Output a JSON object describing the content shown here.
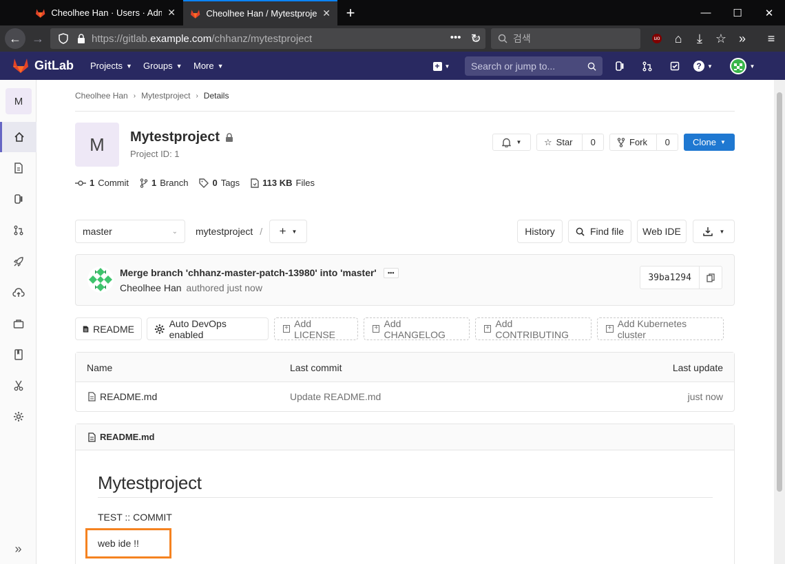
{
  "browser": {
    "tabs": [
      {
        "title": "Cheolhee Han · Users · Admin Area · GitLab"
      },
      {
        "title": "Cheolhee Han / Mytestproject · GitLab"
      }
    ],
    "url_prefix": "https://gitlab.",
    "url_host": "example.com",
    "url_path": "/chhanz/mytestproject",
    "search_placeholder": "검색"
  },
  "gitlab": {
    "brand": "GitLab",
    "nav": [
      {
        "label": "Projects"
      },
      {
        "label": "Groups"
      },
      {
        "label": "More"
      }
    ],
    "search_placeholder": "Search or jump to..."
  },
  "sidebar": {
    "project_letter": "M"
  },
  "breadcrumb": {
    "items": [
      "Cheolhee Han",
      "Mytestproject",
      "Details"
    ]
  },
  "project": {
    "letter": "M",
    "name": "Mytestproject",
    "id_text": "Project ID: 1",
    "star_label": "Star",
    "star_count": "0",
    "fork_label": "Fork",
    "fork_count": "0",
    "clone_label": "Clone"
  },
  "stats": {
    "commits_num": "1",
    "commits_label": "Commit",
    "branches_num": "1",
    "branches_label": "Branch",
    "tags_num": "0",
    "tags_label": "Tags",
    "files_size": "113 KB",
    "files_label": "Files"
  },
  "toolbar": {
    "branch": "master",
    "path": "mytestproject",
    "path_sep": "/",
    "history": "History",
    "find_file": "Find file",
    "web_ide": "Web IDE"
  },
  "last_commit": {
    "message": "Merge branch 'chhanz-master-patch-13980' into 'master'",
    "author": "Cheolhee Han",
    "authored": "authored just now",
    "sha": "39ba1294"
  },
  "quick_buttons": {
    "readme": "README",
    "devops": "Auto DevOps enabled",
    "add_license": "Add LICENSE",
    "add_changelog": "Add CHANGELOG",
    "add_contributing": "Add CONTRIBUTING",
    "add_k8s": "Add Kubernetes cluster"
  },
  "file_tree": {
    "headers": {
      "name": "Name",
      "last_commit": "Last commit",
      "last_update": "Last update"
    },
    "rows": [
      {
        "name": "README.md",
        "commit": "Update README.md",
        "updated": "just now"
      }
    ]
  },
  "readme": {
    "file": "README.md",
    "h1": "Mytestproject",
    "p1": "TEST :: COMMIT",
    "p2": "web ide !!"
  },
  "colors": {
    "gitlab_header": "#292961",
    "clone_button": "#1f78d1",
    "highlight_box": "#f58220"
  }
}
